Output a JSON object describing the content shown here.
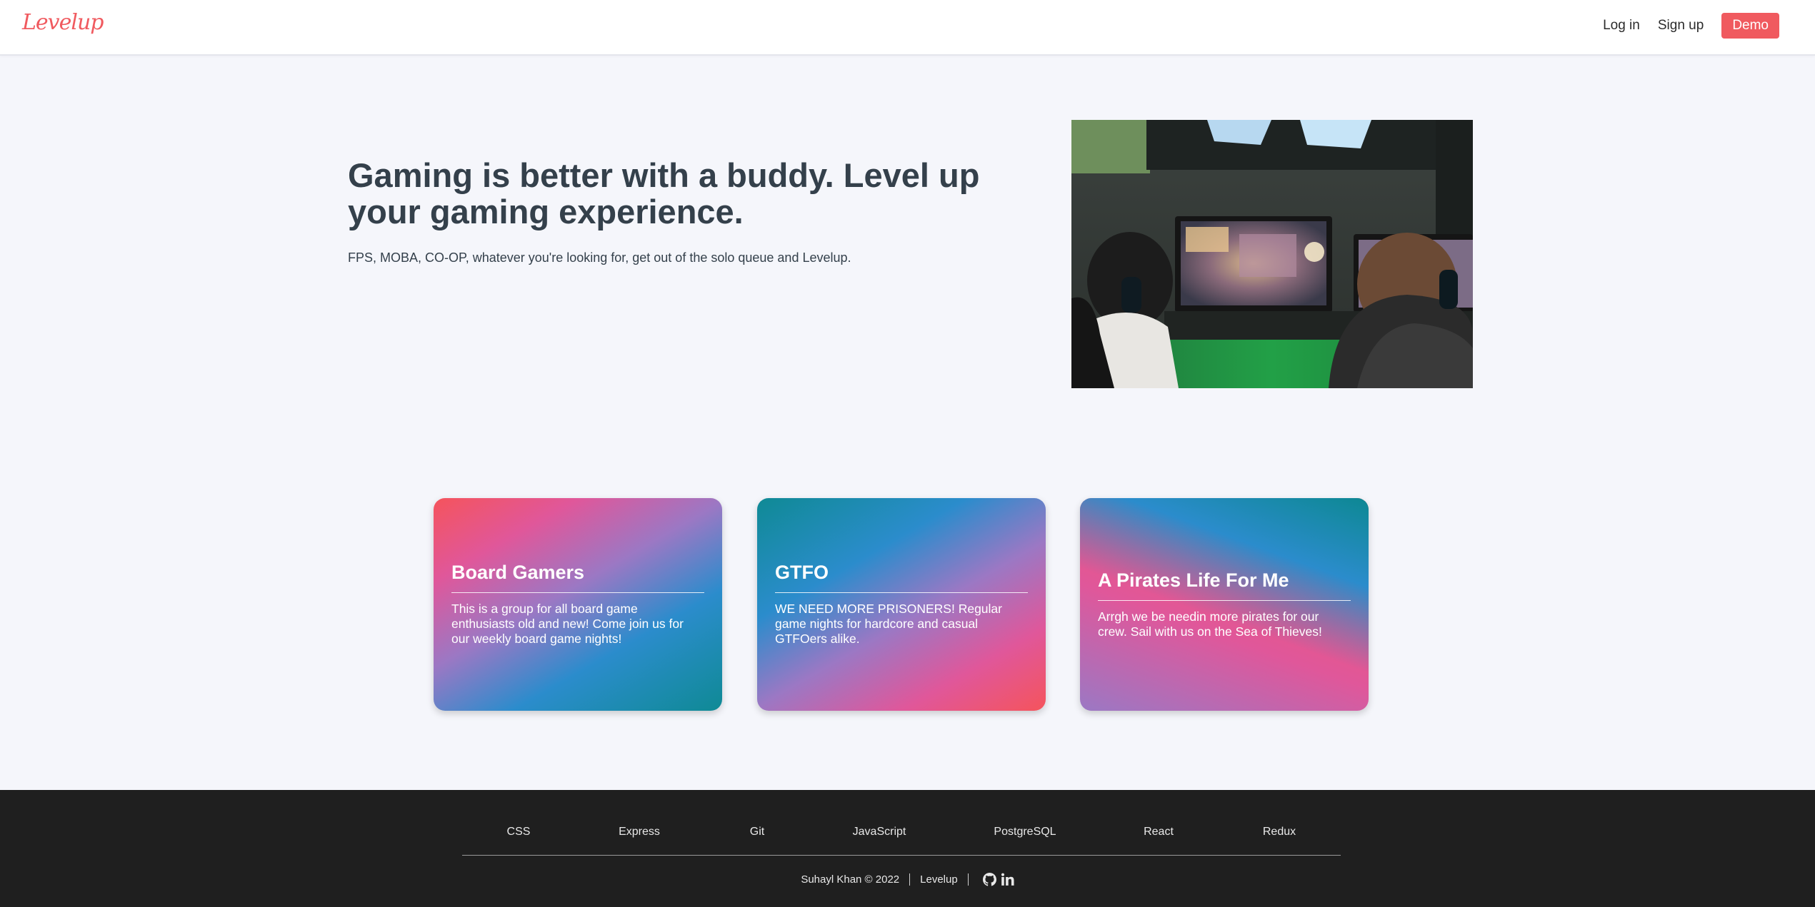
{
  "nav": {
    "logo": "Levelup",
    "login": "Log in",
    "signup": "Sign up",
    "demo": "Demo",
    "brand_color": "#f05a5f"
  },
  "hero": {
    "title": "Gaming is better with a buddy. Level up your gaming experience.",
    "subtitle": "FPS, MOBA, CO-OP, whatever you're looking for, get out of the solo queue and Levelup."
  },
  "cards": [
    {
      "title": "Board Gamers",
      "description": "This is a group for all board game enthusiasts old and new! Come join us for our weekly board game nights!"
    },
    {
      "title": "GTFO",
      "description": "WE NEED MORE PRISONERS! Regular game nights for hardcore and casual GTFOers alike."
    },
    {
      "title": "A Pirates Life For Me",
      "description": "Arrgh we be needin more pirates for our crew. Sail with us on the Sea of Thieves!"
    }
  ],
  "footer": {
    "technologies": [
      "CSS",
      "Express",
      "Git",
      "JavaScript",
      "PostgreSQL",
      "React",
      "Redux"
    ],
    "credit": "Suhayl Khan © 2022",
    "app_name": "Levelup",
    "icons": [
      "github-icon",
      "linkedin-icon"
    ]
  }
}
